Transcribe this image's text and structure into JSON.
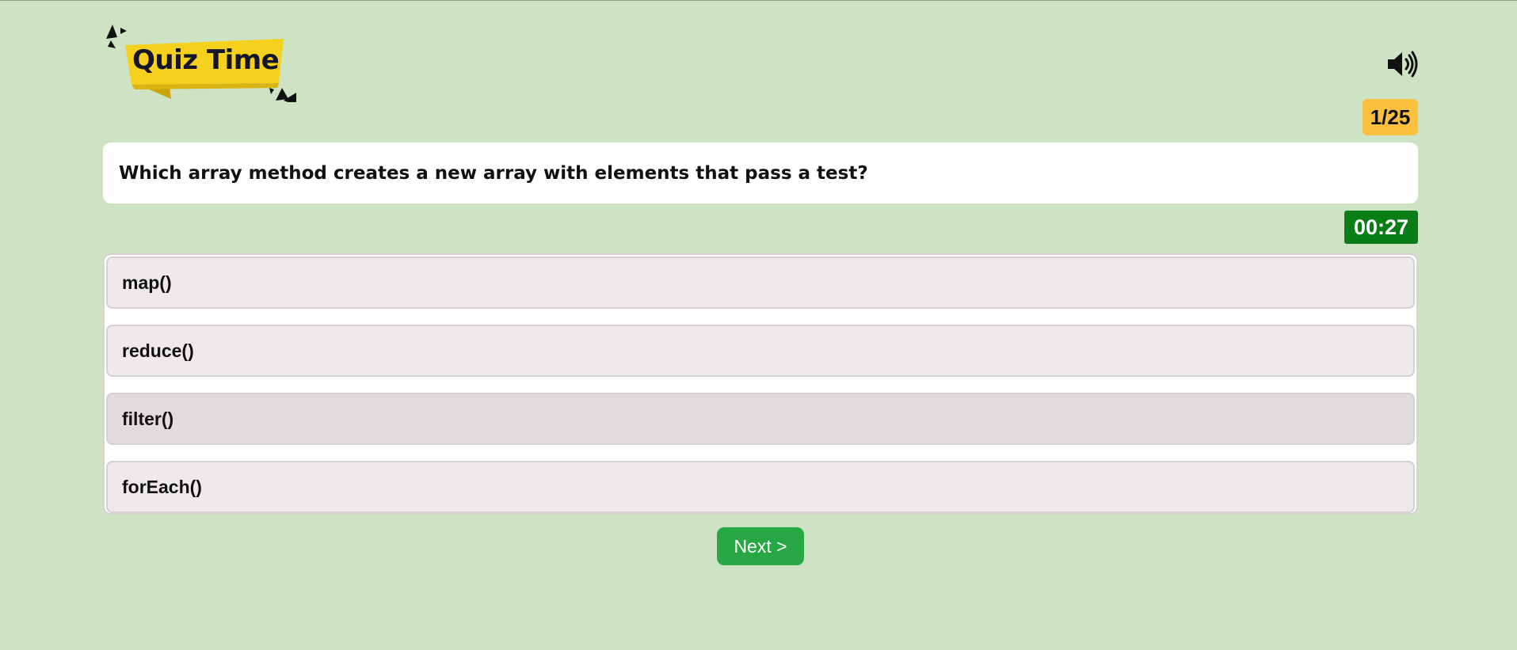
{
  "header": {
    "logo_text": "Quiz Time",
    "sound_icon": "volume-icon"
  },
  "quiz": {
    "counter": "1/25",
    "question": "Which array method creates a new array with elements that pass a test?",
    "timer": "00:27",
    "options": [
      {
        "label": "map()"
      },
      {
        "label": "reduce()"
      },
      {
        "label": "filter()"
      },
      {
        "label": "forEach()"
      }
    ],
    "next_label": "Next >"
  },
  "colors": {
    "background": "#cde3c4",
    "logo_yellow": "#f5d11e",
    "counter_badge": "#fbc13e",
    "timer_badge": "#0a7d16",
    "next_button": "#28a745",
    "option_bg": "#eeeae9",
    "option_hover_bg": "#e3dcdc"
  }
}
